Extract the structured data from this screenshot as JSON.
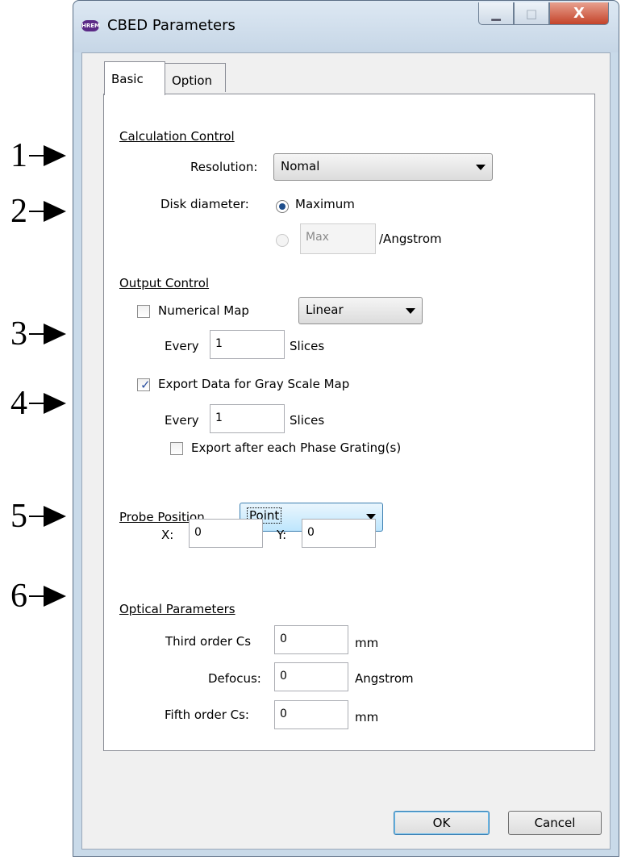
{
  "callouts": [
    "1",
    "2",
    "3",
    "4",
    "5",
    "6"
  ],
  "window": {
    "app_icon_text": "HREM",
    "title": "CBED Parameters",
    "minimize_glyph": "▁",
    "maximize_glyph": "□",
    "close_glyph": "X"
  },
  "tabs": [
    {
      "label": "Basic",
      "active": true
    },
    {
      "label": "Option",
      "active": false
    }
  ],
  "calculation_control": {
    "header": "Calculation Control",
    "resolution_label": "Resolution:",
    "resolution_value": "Nomal",
    "disk_diameter_label": "Disk diameter:",
    "maximum_label": "Maximum",
    "max_field_value": "Max",
    "angstrom_label": "/Angstrom"
  },
  "output_control": {
    "header": "Output Control",
    "numerical_map_label": "Numerical Map",
    "numerical_map_checked": false,
    "numerical_scale_value": "Linear",
    "every_label": "Every",
    "numerical_every_value": "1",
    "slices_label": "Slices",
    "export_gray_label": "Export Data for Gray Scale Map",
    "export_gray_checked": true,
    "gray_every_value": "1",
    "export_after_label": "Export after each Phase Grating(s)",
    "export_after_checked": false
  },
  "probe": {
    "label": "Probe Position",
    "mode_value": "Point",
    "x_label": "X:",
    "x_value": "0",
    "y_label": "Y:",
    "y_value": "0"
  },
  "optical": {
    "header": "Optical Parameters",
    "third_cs_label": "Third order Cs",
    "third_cs_value": "0",
    "third_cs_unit": "mm",
    "defocus_label": "Defocus:",
    "defocus_value": "0",
    "defocus_unit": "Angstrom",
    "fifth_cs_label": "Fifth order Cs:",
    "fifth_cs_value": "0",
    "fifth_cs_unit": "mm"
  },
  "footer": {
    "ok_label": "OK",
    "cancel_label": "Cancel"
  }
}
